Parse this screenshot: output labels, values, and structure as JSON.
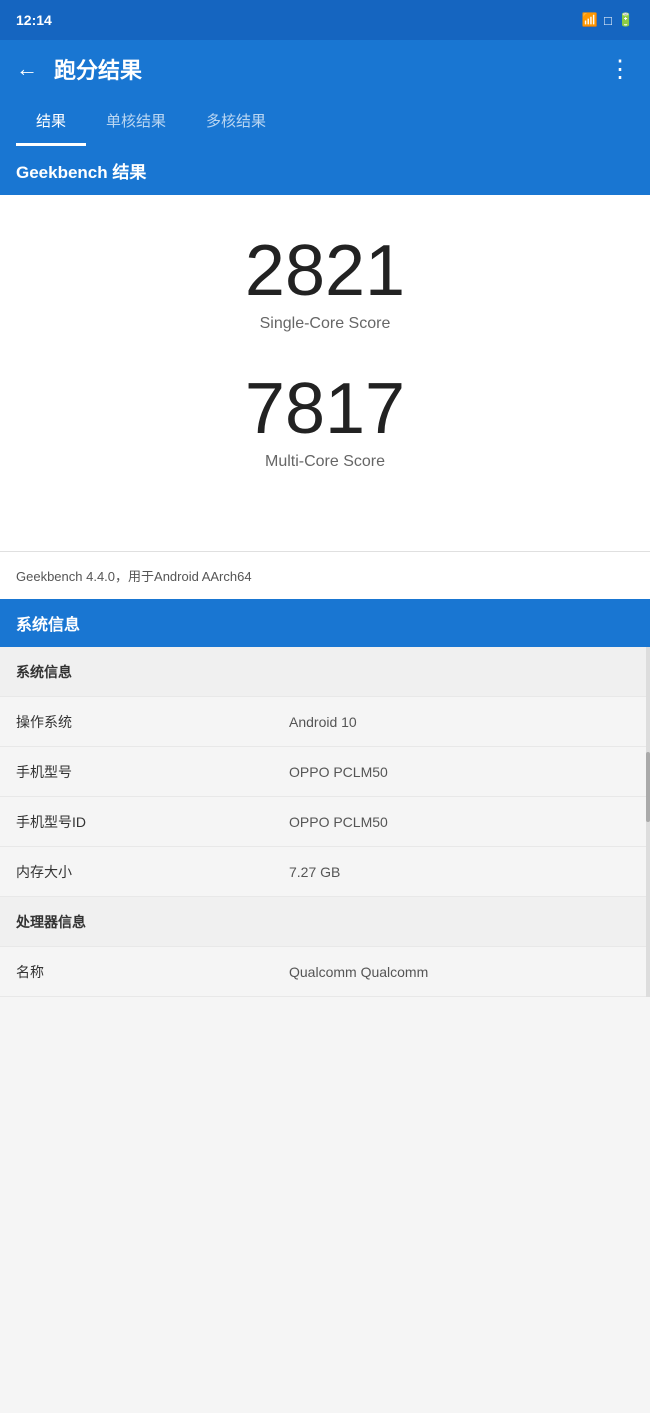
{
  "statusBar": {
    "time": "12:14",
    "icons": [
      "📶",
      "⊙",
      "🔋"
    ]
  },
  "topBar": {
    "title": "跑分结果",
    "backIcon": "←",
    "menuIcon": "⋮"
  },
  "tabs": [
    {
      "label": "结果",
      "active": true
    },
    {
      "label": "单核结果",
      "active": false
    },
    {
      "label": "多核结果",
      "active": false
    }
  ],
  "geekbenchHeader": "Geekbench 结果",
  "scores": [
    {
      "number": "2821",
      "label": "Single-Core Score"
    },
    {
      "number": "7817",
      "label": "Multi-Core Score"
    }
  ],
  "infoLine": "Geekbench 4.4.0，用于Android AArch64",
  "systemInfoHeader": "系统信息",
  "systemInfoRows": [
    {
      "key": "系统信息",
      "value": "",
      "isHeader": true
    },
    {
      "key": "操作系统",
      "value": "Android 10",
      "isHeader": false
    },
    {
      "key": "手机型号",
      "value": "OPPO PCLM50",
      "isHeader": false
    },
    {
      "key": "手机型号ID",
      "value": "OPPO PCLM50",
      "isHeader": false
    },
    {
      "key": "内存大小",
      "value": "7.27 GB",
      "isHeader": false
    },
    {
      "key": "处理器信息",
      "value": "",
      "isHeader": true
    },
    {
      "key": "名称",
      "value": "Qualcomm Qualcomm",
      "isHeader": false
    }
  ]
}
